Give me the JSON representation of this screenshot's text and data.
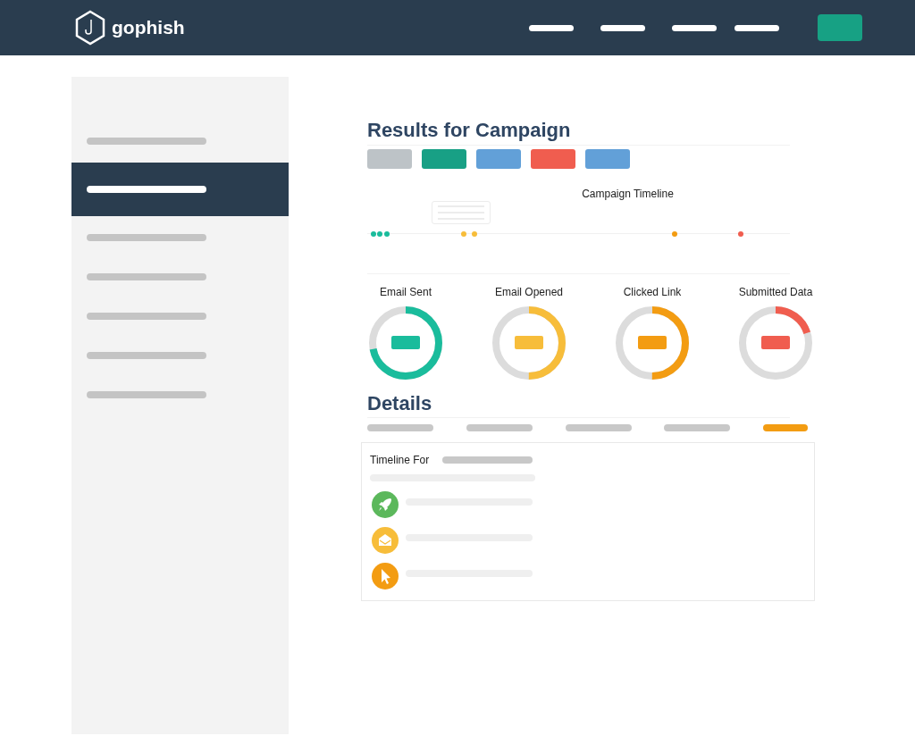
{
  "brand": {
    "name": "gophish"
  },
  "sidebar": {
    "items": [
      {
        "selected": false
      },
      {
        "selected": true
      },
      {
        "selected": false
      },
      {
        "selected": false
      },
      {
        "selected": false
      },
      {
        "selected": false
      },
      {
        "selected": false
      }
    ]
  },
  "results": {
    "title": "Results for Campaign",
    "buttons": [
      {
        "color": "#bdc3c7"
      },
      {
        "color": "#18a085"
      },
      {
        "color": "#62a0d8"
      },
      {
        "color": "#f05d4f"
      },
      {
        "color": "#62a0d8"
      }
    ],
    "timeline": {
      "title": "Campaign Timeline",
      "events": [
        {
          "color": "#1abc9c"
        },
        {
          "color": "#1abc9c"
        },
        {
          "color": "#1abc9c"
        },
        {
          "color": "#f7bd3a"
        },
        {
          "color": "#f7bd3a"
        },
        {
          "color": "#f39c12"
        },
        {
          "color": "#f05d4f"
        }
      ]
    },
    "stats": [
      {
        "label": "Email Sent",
        "level": 0.72,
        "color": "#1abc9c"
      },
      {
        "label": "Email Opened",
        "level": 0.5,
        "color": "#f7bd3a"
      },
      {
        "label": "Clicked Link",
        "level": 0.5,
        "color": "#f39c12"
      },
      {
        "label": "Submitted Data",
        "level": 0.2,
        "color": "#f05d4f"
      }
    ]
  },
  "details": {
    "title": "Details",
    "tabs": [
      {
        "selected": false
      },
      {
        "selected": false
      },
      {
        "selected": false
      },
      {
        "selected": false
      },
      {
        "selected": true
      }
    ],
    "panel": {
      "title": "Timeline For",
      "events": [
        {
          "kind": "rocket",
          "color": "#5cb85c"
        },
        {
          "kind": "envelope",
          "color": "#f7bd3a"
        },
        {
          "kind": "cursor",
          "color": "#f39c12"
        }
      ]
    }
  }
}
